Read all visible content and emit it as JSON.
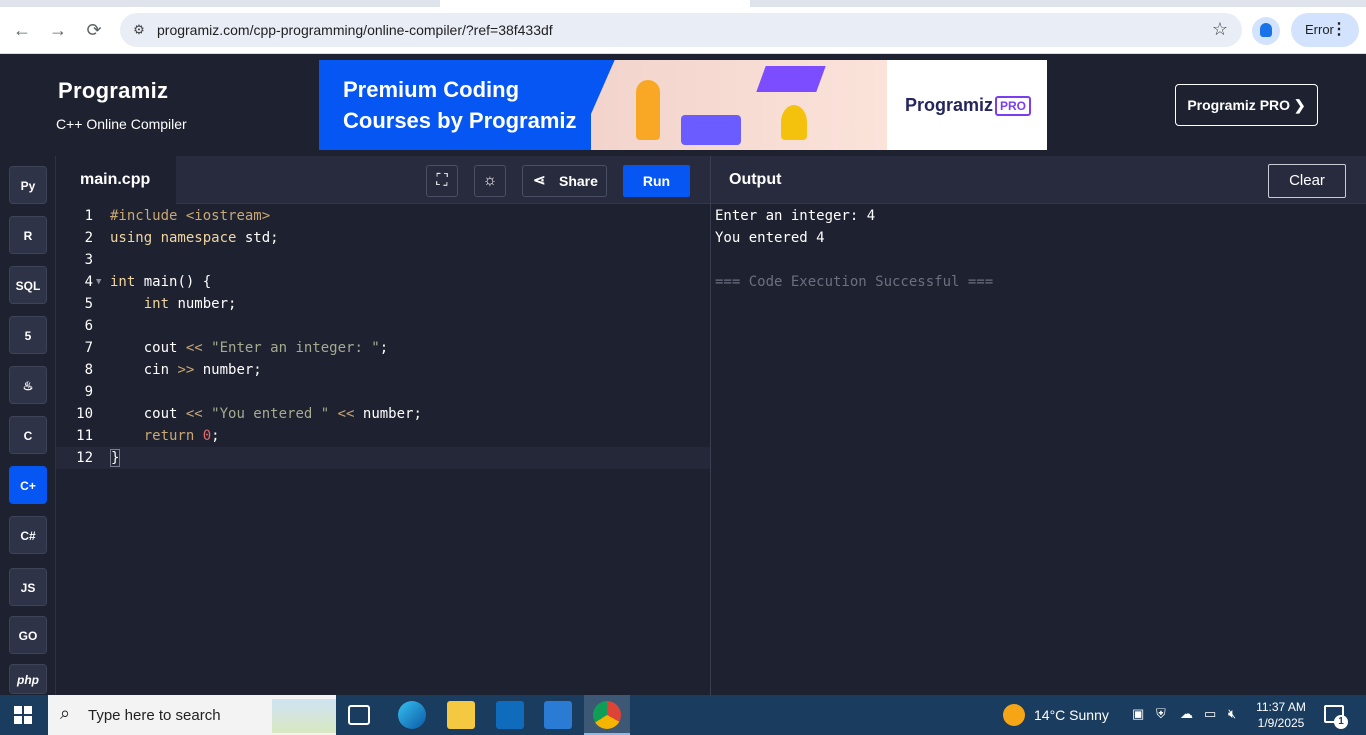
{
  "browser": {
    "url": "programiz.com/cpp-programming/online-compiler/?ref=38f433df",
    "profile_chip": "Error"
  },
  "header": {
    "logo": "Programiz",
    "subtitle": "C++ Online Compiler",
    "banner_title": "Premium Coding\nCourses by Programiz",
    "banner_brand": "Programiz",
    "banner_badge": "PRO",
    "pro_button": "Programiz PRO ❯"
  },
  "sidebar": {
    "languages": [
      {
        "label": "Py",
        "icon": "python-icon"
      },
      {
        "label": "R",
        "icon": "r-icon"
      },
      {
        "label": "SQL",
        "icon": "sql-icon"
      },
      {
        "label": "5",
        "icon": "html5-icon"
      },
      {
        "label": "♨",
        "icon": "java-icon"
      },
      {
        "label": "C",
        "icon": "c-icon"
      },
      {
        "label": "C+",
        "icon": "cpp-icon",
        "active": true
      },
      {
        "label": "C#",
        "icon": "csharp-icon"
      },
      {
        "label": "JS",
        "icon": "javascript-icon"
      },
      {
        "label": "GO",
        "icon": "go-icon"
      },
      {
        "label": "php",
        "icon": "php-icon"
      }
    ]
  },
  "editor": {
    "file_tab": "main.cpp",
    "share_label": "Share",
    "run_label": "Run",
    "lines": [
      "#include <iostream>",
      "using namespace std;",
      "",
      "int main() {",
      "    int number;",
      "",
      "    cout << \"Enter an integer: \";",
      "    cin >> number;",
      "",
      "    cout << \"You entered \" << number;",
      "    return 0;",
      "}"
    ]
  },
  "output": {
    "title": "Output",
    "clear_label": "Clear",
    "lines": [
      "Enter an integer: 4",
      "You entered 4",
      "",
      "=== Code Execution Successful ==="
    ]
  },
  "taskbar": {
    "search_placeholder": "Type here to search",
    "weather": "14°C  Sunny",
    "time": "11:37 AM",
    "date": "1/9/2025",
    "notification_count": "1"
  },
  "colors": {
    "accent": "#0556f3",
    "background": "#1e2130"
  }
}
